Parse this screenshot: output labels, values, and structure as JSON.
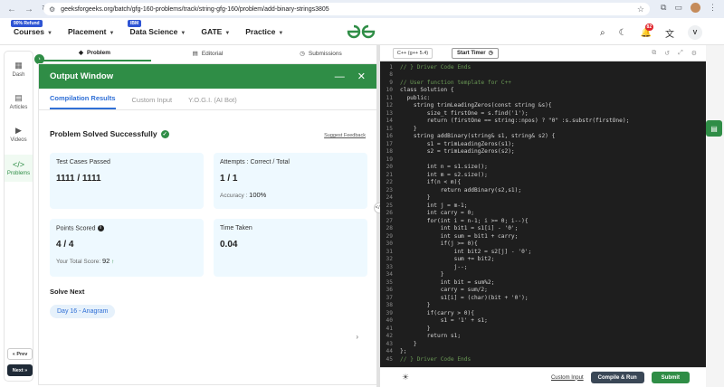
{
  "browser": {
    "url": "geeksforgeeks.org/batch/gfg-160-problems/track/string-gfg-160/problem/add-binary-strings3805"
  },
  "header": {
    "refund_badge": "90% Refund",
    "ibm_badge": "IBM",
    "menu": [
      "Courses",
      "Placement",
      "Data Science",
      "GATE",
      "Practice"
    ],
    "logo": "GfG",
    "notification_count": "82",
    "user_initial": "V"
  },
  "rail": {
    "items": [
      "Dash",
      "Articles",
      "Videos",
      "Problems"
    ],
    "prev": "« Prev",
    "next": "Next »"
  },
  "problem_tabs": [
    "Problem",
    "Editorial",
    "Submissions"
  ],
  "output": {
    "title": "Output Window",
    "tabs": [
      "Compilation Results",
      "Custom Input",
      "Y.O.G.I. (AI Bot)"
    ],
    "status": "Problem Solved Successfully",
    "suggest_feedback": "Suggest Feedback",
    "cards": {
      "test_cases_label": "Test Cases Passed",
      "test_cases_value": "1111 / 1111",
      "attempts_label": "Attempts : Correct / Total",
      "attempts_value": "1 / 1",
      "accuracy_label": "Accuracy :",
      "accuracy_value": "100%",
      "points_label": "Points Scored",
      "points_value": "4 / 4",
      "total_score_label": "Your Total Score:",
      "total_score_value": "92",
      "time_label": "Time Taken",
      "time_value": "0.04"
    },
    "solve_next": "Solve Next",
    "next_problem": "Day 16 - Anagram"
  },
  "editor": {
    "language": "C++ (g++ 5.4)",
    "timer": "Start Timer",
    "lines": [
      {
        "n": "1",
        "t": "// } Driver Code Ends",
        "c": "#6a9955"
      },
      {
        "n": "8",
        "t": "",
        "c": "#d4d4d4"
      },
      {
        "n": "9",
        "t": "// User function template for C++",
        "c": "#6a9955"
      },
      {
        "n": "10",
        "t": "class Solution {",
        "c": "#d4d4d4"
      },
      {
        "n": "11",
        "t": "  public:",
        "c": "#d4d4d4"
      },
      {
        "n": "12",
        "t": "    string trimLeadingZeros(const string &s){",
        "c": "#d4d4d4"
      },
      {
        "n": "13",
        "t": "        size_t firstOne = s.find('1');",
        "c": "#d4d4d4"
      },
      {
        "n": "14",
        "t": "        return (firstOne == string::npos) ? \"0\" :s.substr(firstOne);",
        "c": "#d4d4d4"
      },
      {
        "n": "15",
        "t": "    }",
        "c": "#d4d4d4"
      },
      {
        "n": "16",
        "t": "    string addBinary(string& s1, string& s2) {",
        "c": "#d4d4d4"
      },
      {
        "n": "17",
        "t": "        s1 = trimLeadingZeros(s1);",
        "c": "#d4d4d4"
      },
      {
        "n": "18",
        "t": "        s2 = trimLeadingZeros(s2);",
        "c": "#d4d4d4"
      },
      {
        "n": "19",
        "t": "",
        "c": "#d4d4d4"
      },
      {
        "n": "20",
        "t": "        int n = s1.size();",
        "c": "#d4d4d4"
      },
      {
        "n": "21",
        "t": "        int m = s2.size();",
        "c": "#d4d4d4"
      },
      {
        "n": "22",
        "t": "        if(n < m){",
        "c": "#d4d4d4"
      },
      {
        "n": "23",
        "t": "            return addBinary(s2,s1);",
        "c": "#d4d4d4"
      },
      {
        "n": "24",
        "t": "        }",
        "c": "#d4d4d4"
      },
      {
        "n": "25",
        "t": "        int j = m-1;",
        "c": "#d4d4d4"
      },
      {
        "n": "26",
        "t": "        int carry = 0;",
        "c": "#d4d4d4"
      },
      {
        "n": "27",
        "t": "        for(int i = n-1; i >= 0; i--){",
        "c": "#d4d4d4"
      },
      {
        "n": "28",
        "t": "            int bit1 = s1[i] - '0';",
        "c": "#d4d4d4"
      },
      {
        "n": "29",
        "t": "            int sum = bit1 + carry;",
        "c": "#d4d4d4"
      },
      {
        "n": "30",
        "t": "            if(j >= 0){",
        "c": "#d4d4d4"
      },
      {
        "n": "31",
        "t": "                int bit2 = s2[j] - '0';",
        "c": "#d4d4d4"
      },
      {
        "n": "32",
        "t": "                sum += bit2;",
        "c": "#d4d4d4"
      },
      {
        "n": "33",
        "t": "                j--;",
        "c": "#d4d4d4"
      },
      {
        "n": "34",
        "t": "            }",
        "c": "#d4d4d4"
      },
      {
        "n": "35",
        "t": "            int bit = sum%2;",
        "c": "#d4d4d4"
      },
      {
        "n": "36",
        "t": "            carry = sum/2;",
        "c": "#d4d4d4"
      },
      {
        "n": "37",
        "t": "            s1[i] = (char)(bit + '0');",
        "c": "#d4d4d4"
      },
      {
        "n": "38",
        "t": "        }",
        "c": "#d4d4d4"
      },
      {
        "n": "39",
        "t": "        if(carry > 0){",
        "c": "#d4d4d4"
      },
      {
        "n": "40",
        "t": "            s1 = '1' + s1;",
        "c": "#d4d4d4"
      },
      {
        "n": "41",
        "t": "        }",
        "c": "#d4d4d4"
      },
      {
        "n": "42",
        "t": "        return s1;",
        "c": "#d4d4d4"
      },
      {
        "n": "43",
        "t": "    }",
        "c": "#d4d4d4"
      },
      {
        "n": "44",
        "t": "};",
        "c": "#d4d4d4"
      },
      {
        "n": "45",
        "t": "// } Driver Code Ends",
        "c": "#6a9955"
      }
    ],
    "custom_input": "Custom Input",
    "compile_run": "Compile & Run",
    "submit": "Submit"
  },
  "colors": {
    "brand_green": "#2f8d46",
    "accent_blue": "#2f6fd6",
    "editor_bg": "#1e1e1e"
  }
}
